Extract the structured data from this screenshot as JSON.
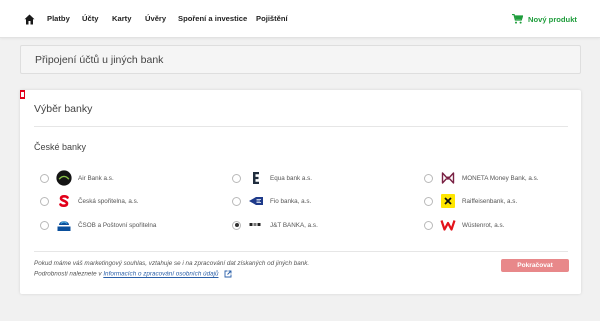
{
  "nav": {
    "items": [
      "Platby",
      "Účty",
      "Karty",
      "Úvěry",
      "Spoření a investice",
      "Pojištění"
    ],
    "new_product": "Nový produkt"
  },
  "header": {
    "title": "Připojení účtů u jiných bank"
  },
  "selection": {
    "title": "Výběr banky",
    "group_title": "České banky",
    "banks": [
      {
        "name": "Air Bank a.s.",
        "selected": false
      },
      {
        "name": "Equa bank a.s.",
        "selected": false
      },
      {
        "name": "MONETA Money Bank, a.s.",
        "selected": false
      },
      {
        "name": "Česká spořitelna, a.s.",
        "selected": false
      },
      {
        "name": "Fio banka, a.s.",
        "selected": false
      },
      {
        "name": "Raiffeisenbank, a.s.",
        "selected": false
      },
      {
        "name": "ČSOB a Poštovní spořitelna",
        "selected": false
      },
      {
        "name": "J&T BANKA, a.s.",
        "selected": true
      },
      {
        "name": "Wüstenrot, a.s.",
        "selected": false
      }
    ],
    "note_line1": "Pokud máme váš marketingový souhlas, vztahuje se i na zpracování dat získaných od jiných bank.",
    "note_line2_prefix": "Podrobnosti naleznete v",
    "note_link": "Informacích o zpracování osobních údajů",
    "continue_button": "Pokračovat"
  },
  "colors": {
    "accent_red": "#e1001a",
    "brand_green": "#1f9d3c",
    "button_disabled": "#e8888a",
    "link": "#2a5fa8"
  }
}
